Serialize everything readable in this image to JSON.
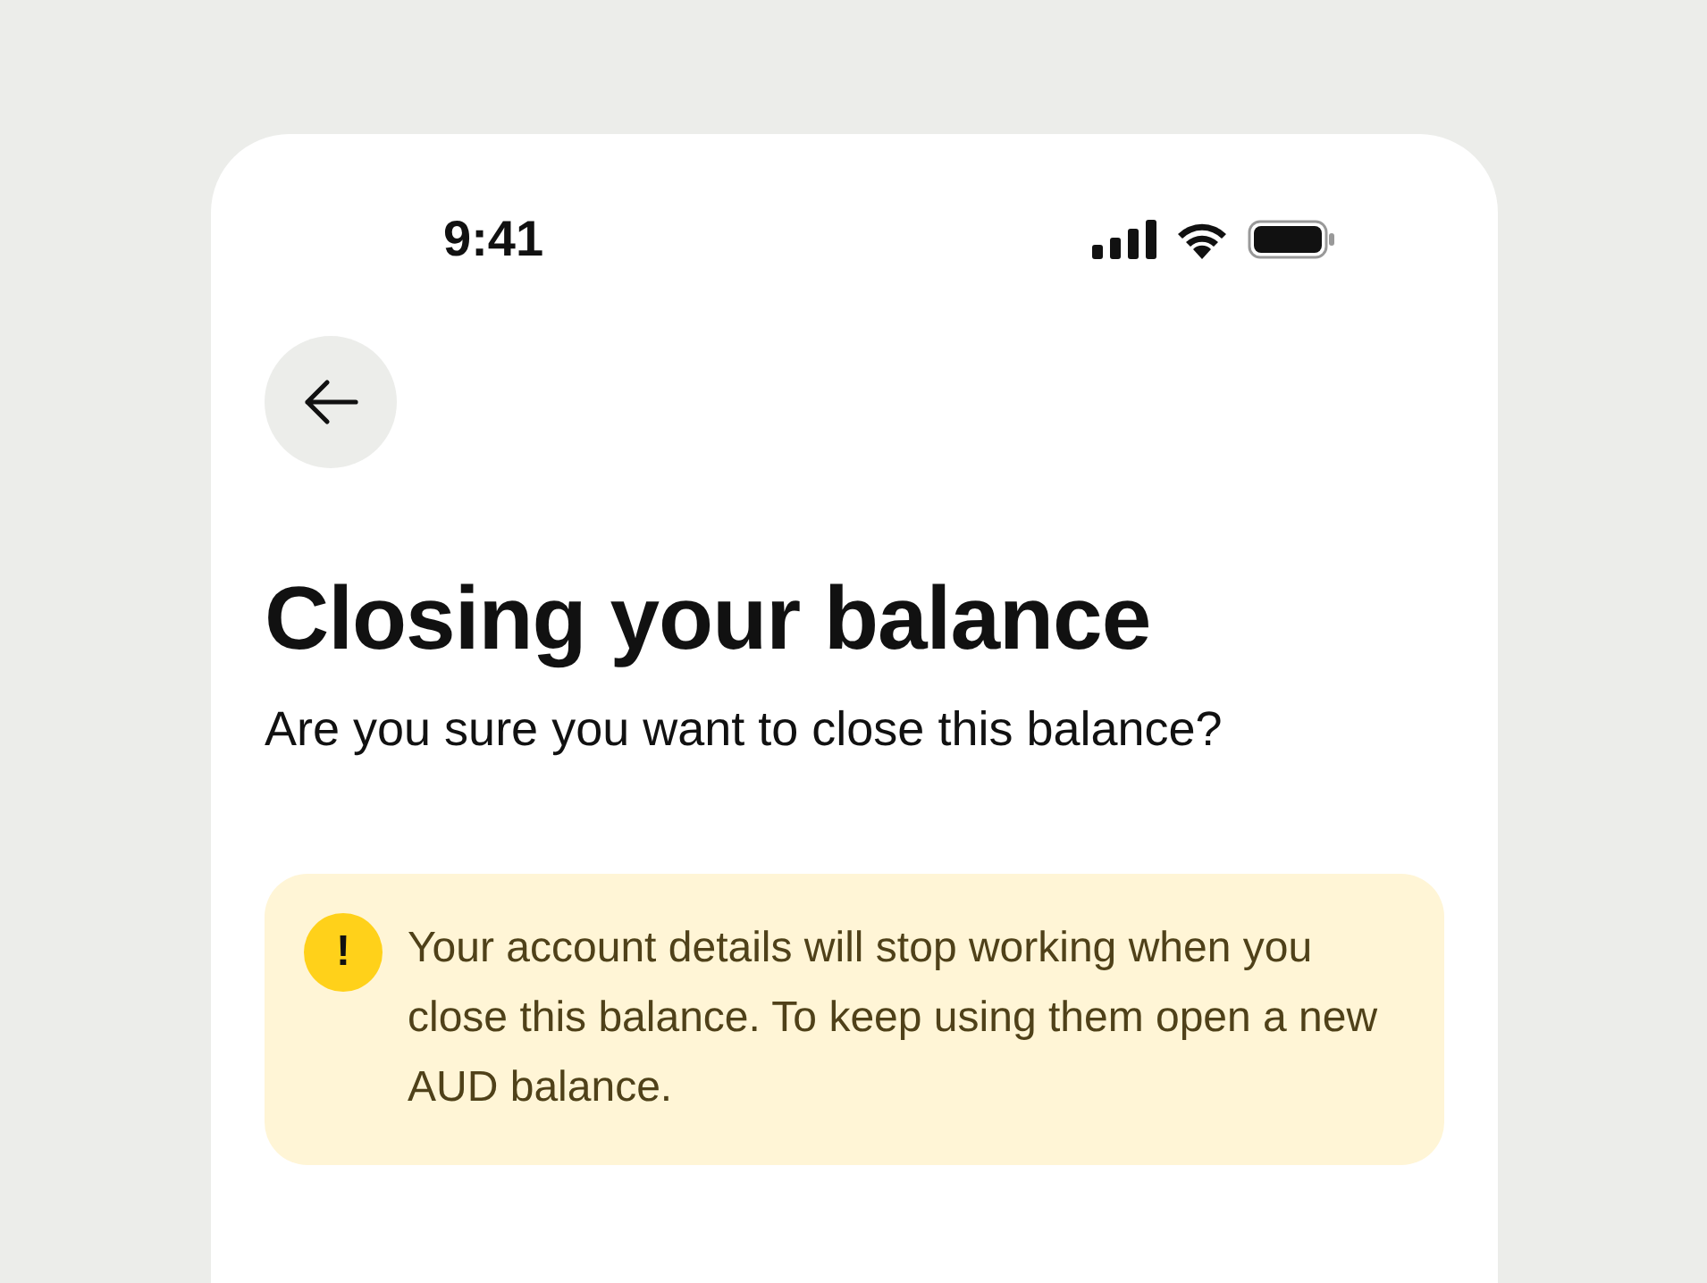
{
  "status_bar": {
    "time": "9:41"
  },
  "title": "Closing your balance",
  "subtitle": "Are you sure you want to close this balance?",
  "alert": {
    "kind": "warning",
    "glyph": "!",
    "text": "Your account details will stop working when you close this balance. To keep using them open a new AUD balance."
  }
}
